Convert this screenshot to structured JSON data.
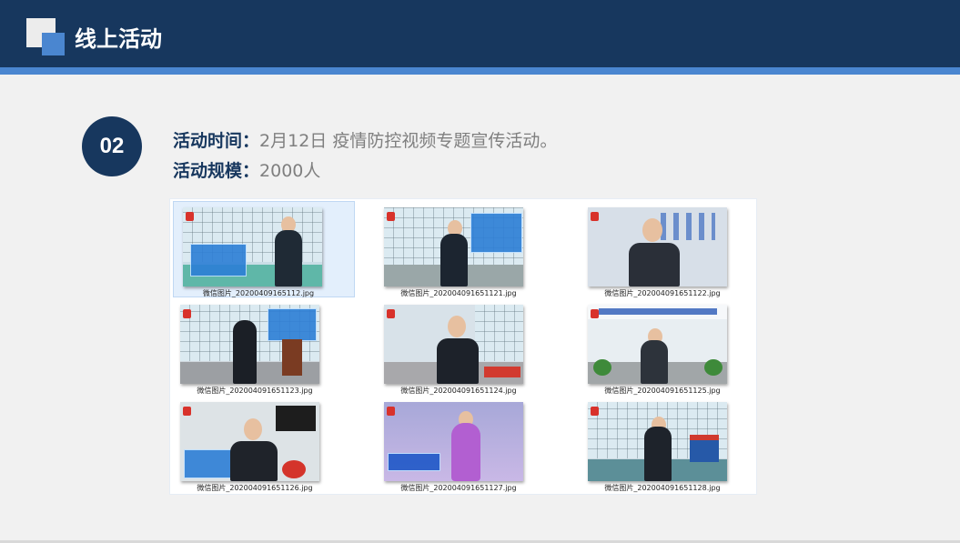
{
  "header": {
    "title": "线上活动"
  },
  "item": {
    "number": "02",
    "time_label": "活动时间：",
    "time_value": "2月12日  疫情防控视频专题宣传活动。",
    "scale_label": "活动规模：",
    "scale_value": "2000人"
  },
  "gallery": {
    "files": [
      "微信图片_20200409165112.jpg",
      "微信图片_202004091651121.jpg",
      "微信图片_202004091651122.jpg",
      "微信图片_202004091651123.jpg",
      "微信图片_202004091651124.jpg",
      "微信图片_202004091651125.jpg",
      "微信图片_202004091651126.jpg",
      "微信图片_202004091651127.jpg",
      "微信图片_202004091651128.jpg"
    ],
    "selected_index": 0
  },
  "colors": {
    "header": "#17375e",
    "accent": "#4a86d0",
    "label": "#17375e",
    "body_text": "#7f7f7f"
  }
}
